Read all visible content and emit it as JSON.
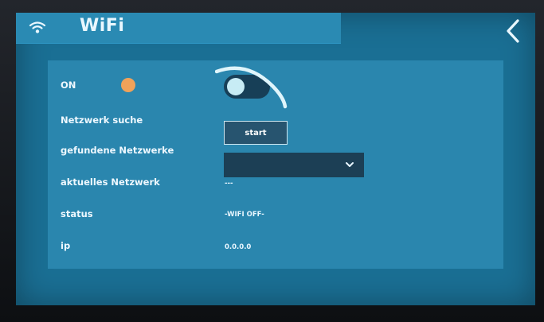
{
  "header": {
    "title": "WiFi",
    "wifi_icon": "wifi-icon",
    "back_icon": "chevron-left-icon"
  },
  "settings": {
    "on": {
      "label": "ON",
      "toggle_state": "on",
      "indicator_color": "#f0a25a"
    },
    "scan": {
      "label": "Netzwerk suche",
      "button_label": "start"
    },
    "found": {
      "label": "gefundene Netzwerke",
      "selected_value": ""
    },
    "current": {
      "label": "aktuelles Netzwerk",
      "value": "---"
    },
    "status": {
      "label": "status",
      "value": "-WIFI OFF-"
    },
    "ip": {
      "label": "ip",
      "value": "0.0.0.0"
    }
  },
  "colors": {
    "screen_bg": "#1a6f94",
    "panel_bg": "#2a86ae",
    "header_bg": "#2a8ab3",
    "control_dark": "#1c3f55"
  }
}
